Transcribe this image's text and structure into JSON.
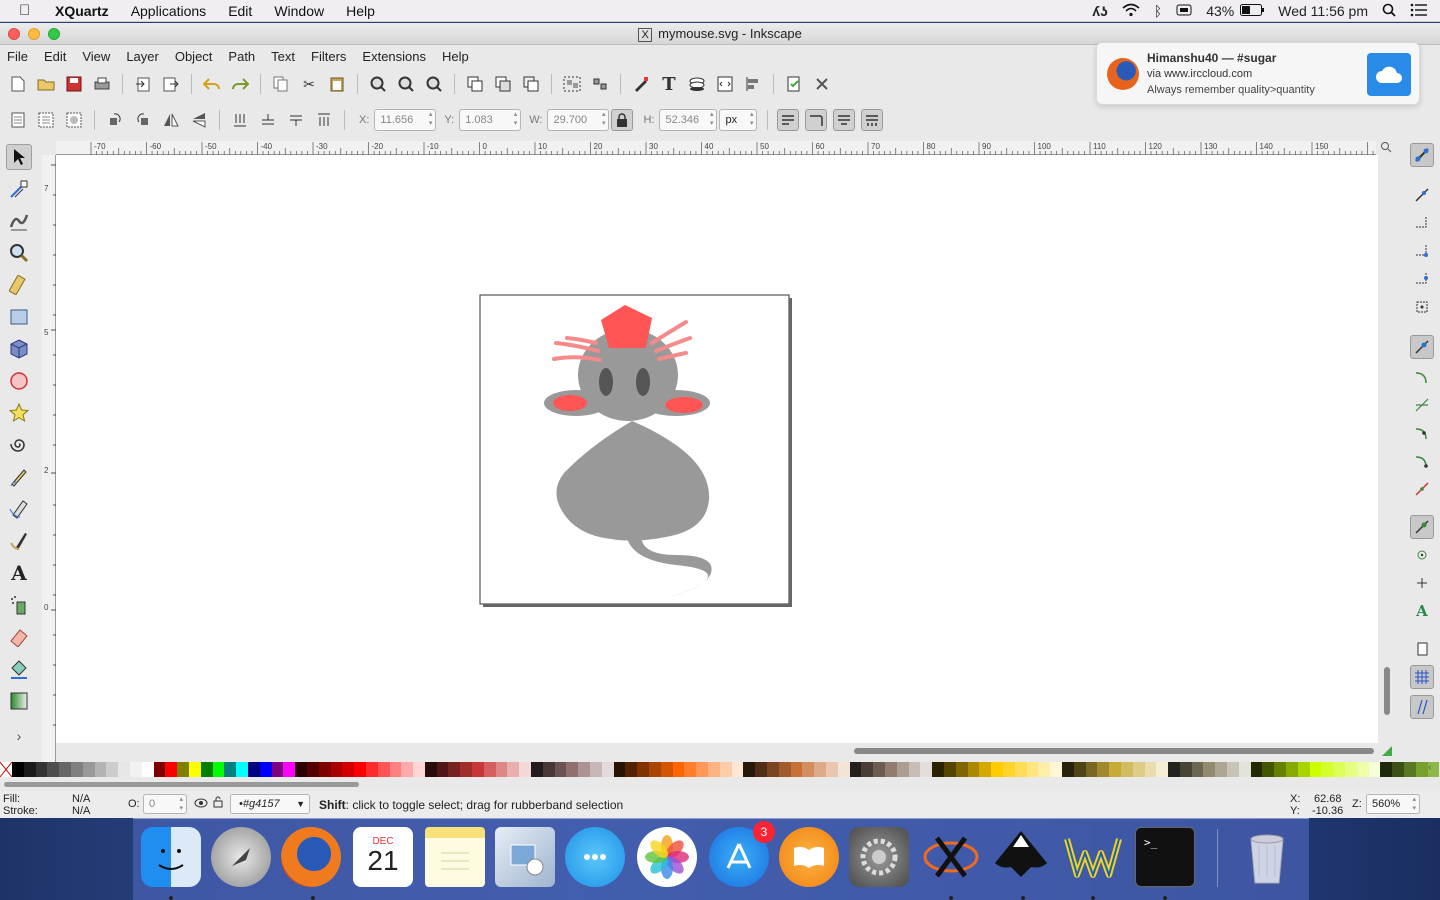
{
  "mac_menubar": {
    "app_name": "XQuartz",
    "items": [
      "Applications",
      "Edit",
      "Window",
      "Help"
    ],
    "battery": "43%",
    "clock": "Wed 11:56 pm"
  },
  "window": {
    "title": "mymouse.svg - Inkscape",
    "title_icon": "X"
  },
  "app_menu": [
    "File",
    "Edit",
    "View",
    "Layer",
    "Object",
    "Path",
    "Text",
    "Filters",
    "Extensions",
    "Help"
  ],
  "tool_controls": {
    "x_label": "X:",
    "x_value": "11.656",
    "y_label": "Y:",
    "y_value": "1.083",
    "w_label": "W:",
    "w_value": "29.700",
    "h_label": "H:",
    "h_value": "52.346",
    "unit": "px"
  },
  "ruler_labels": [
    "-70",
    "-60",
    "-50",
    "-40",
    "-30",
    "-20",
    "-10",
    "0",
    "10",
    "20",
    "30",
    "40",
    "50",
    "60",
    "70",
    "80",
    "90",
    "100",
    "110",
    "120",
    "130",
    "140",
    "150"
  ],
  "vruler_labels": [
    "7",
    "5",
    "2",
    "0"
  ],
  "notification": {
    "title": "Himanshu40 — #sugar",
    "subtitle": "via www.irccloud.com",
    "body": "Always remember quality>quantity"
  },
  "status": {
    "fill_label": "Fill:",
    "fill_value": "N/A",
    "stroke_label": "Stroke:",
    "stroke_value": "N/A",
    "opacity_label": "O:",
    "opacity_value": "0",
    "layer": "•#g4157",
    "message_bold": "Shift",
    "message": ": click to toggle select; drag for rubberband selection",
    "cursor_x_label": "X:",
    "cursor_x": "62.68",
    "cursor_y_label": "Y:",
    "cursor_y": "-10.36",
    "zoom_label": "Z:",
    "zoom": "560%"
  },
  "dock": {
    "calendar_month": "DEC",
    "calendar_day": "21",
    "appstore_badge": "3"
  },
  "colors": {
    "mouse_body": "#999999",
    "mouse_accent": "#ff5555",
    "accent_blue": "#2a72d8"
  }
}
